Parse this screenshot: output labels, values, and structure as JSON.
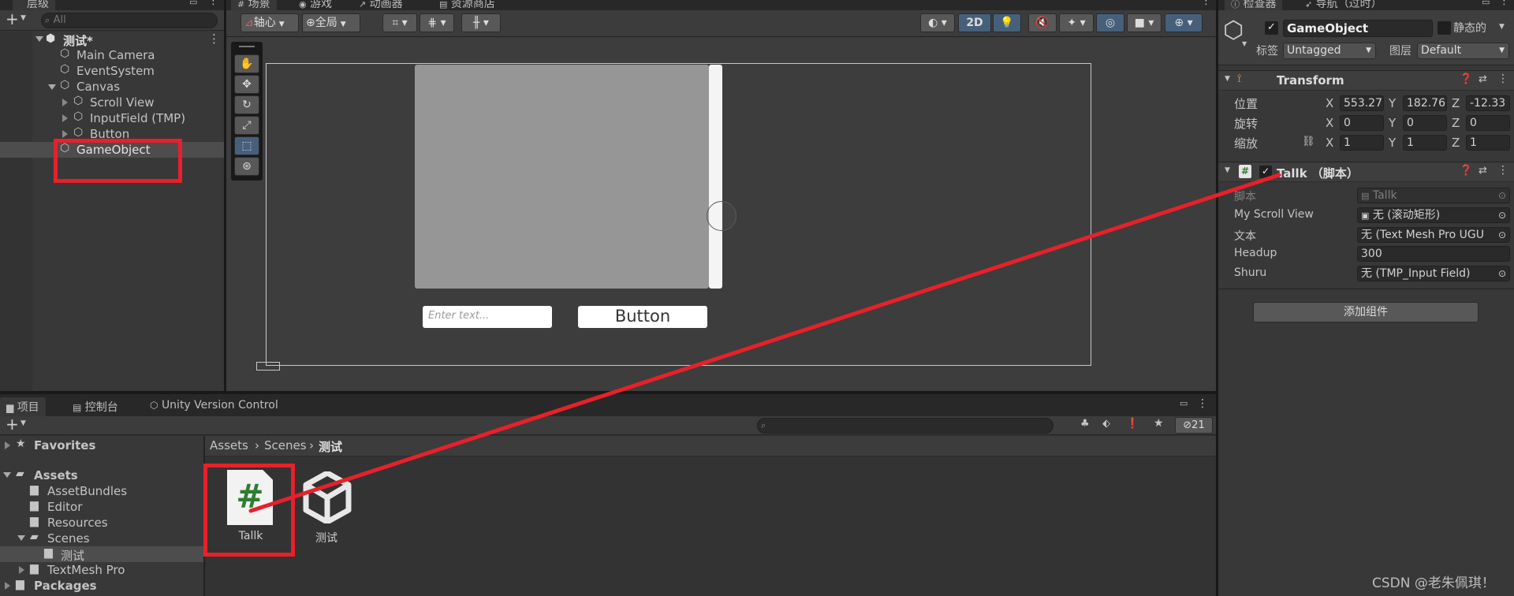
{
  "hierarchy": {
    "tab_label": "层级",
    "search_placeholder": "All",
    "items": [
      {
        "label": "测试*"
      },
      {
        "label": "Main Camera"
      },
      {
        "label": "EventSystem"
      },
      {
        "label": "Canvas"
      },
      {
        "label": "Scroll View"
      },
      {
        "label": "InputField (TMP)"
      },
      {
        "label": "Button"
      },
      {
        "label": "GameObject"
      }
    ]
  },
  "scene": {
    "tabs": [
      "场景",
      "游戏",
      "动画器",
      "资源商店"
    ],
    "toolbar": {
      "pivot": "轴心",
      "global": "全局",
      "mode_2d": "2D"
    },
    "canvas": {
      "input_placeholder": "Enter text...",
      "button_label": "Button"
    }
  },
  "inspector": {
    "tabs": [
      "检查器",
      "导航（过时）"
    ],
    "object_name": "GameObject",
    "static_label": "静态的",
    "tag_label": "标签",
    "tag_value": "Untagged",
    "layer_label": "图层",
    "layer_value": "Default",
    "transform": {
      "title": "Transform",
      "position_label": "位置",
      "rotation_label": "旋转",
      "scale_label": "缩放",
      "axes": [
        "X",
        "Y",
        "Z"
      ],
      "position": [
        "553.27",
        "182.76",
        "-12.33"
      ],
      "rotation": [
        "0",
        "0",
        "0"
      ],
      "scale": [
        "1",
        "1",
        "1"
      ]
    },
    "script_component": {
      "title": "Tallk （脚本）",
      "fields": [
        {
          "label": "脚本",
          "value": "Tallk"
        },
        {
          "label": "My Scroll View",
          "value": "无 (滚动矩形)"
        },
        {
          "label": "文本",
          "value": "无 (Text Mesh Pro UGU"
        },
        {
          "label": "Headup",
          "value": "300"
        },
        {
          "label": "Shuru",
          "value": "无 (TMP_Input Field)"
        }
      ]
    },
    "add_component": "添加组件"
  },
  "project": {
    "tabs": [
      "项目",
      "控制台",
      "Unity Version Control"
    ],
    "hidden_count": "21",
    "tree": [
      {
        "label": "Favorites"
      },
      {
        "label": "Assets"
      },
      {
        "label": "AssetBundles"
      },
      {
        "label": "Editor"
      },
      {
        "label": "Resources"
      },
      {
        "label": "Scenes"
      },
      {
        "label": "测试"
      },
      {
        "label": "TextMesh Pro"
      },
      {
        "label": "Packages"
      }
    ],
    "breadcrumb": [
      "Assets",
      "Scenes",
      "测试"
    ],
    "assets": [
      {
        "label": "Tallk",
        "icon": "csharp-script-icon"
      },
      {
        "label": "测试",
        "icon": "unity-scene-icon"
      }
    ]
  },
  "watermark": "CSDN @老朱佩琪！",
  "colors": {
    "annotation_red": "#e8202a",
    "selection": "#4d4d4d",
    "accent_blue": "#46607c",
    "script_green": "#2e7d32"
  }
}
